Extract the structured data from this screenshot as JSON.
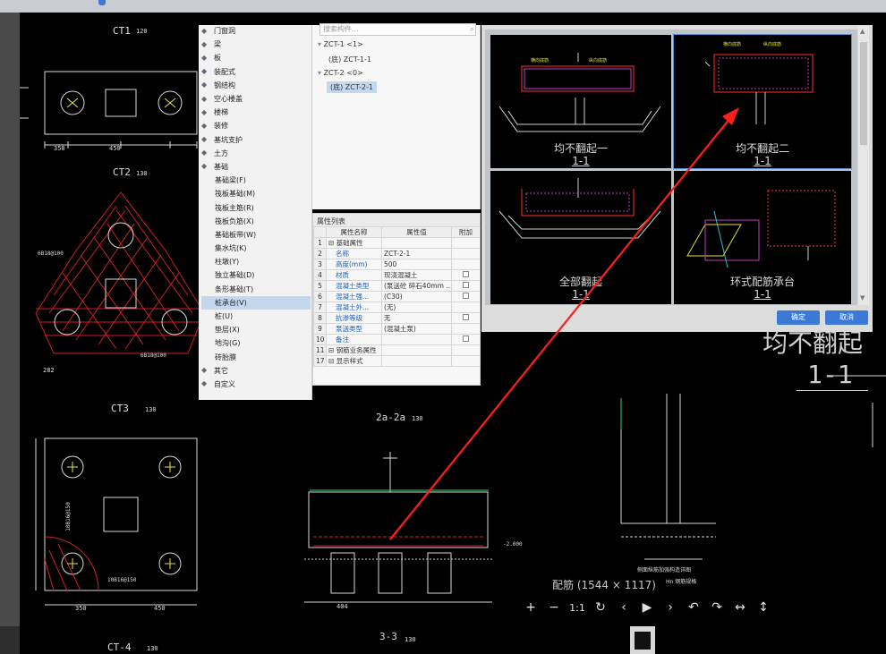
{
  "cad": {
    "labels": {
      "ct1": "CT1",
      "ct1_scale": "120",
      "ct2": "CT2",
      "ct2_scale": "130",
      "ct3": "CT3",
      "ct3_scale": "130",
      "ct4": "CT-4",
      "ct4_scale": "130",
      "sec22": "2a-2a",
      "sec22_scale": "130",
      "sec33": "3-3",
      "sec33_scale": "130",
      "dim350": "350",
      "dim450": "450",
      "dim404": "404",
      "dim282": "282",
      "rebar1": "6B18@100",
      "rebar2": "6B18@100",
      "rebar3": "10B16@150",
      "rebar4": "10B16@150",
      "elev": "-2.000",
      "big_caption": "均不翻起",
      "big_section": "1-1",
      "detail_title": "侧面纵筋加强构造详图",
      "detail_sub": "Hn 钢筋规格"
    }
  },
  "tree": {
    "items": [
      {
        "label": "门窗洞",
        "icon": "door-icon"
      },
      {
        "label": "梁",
        "icon": "beam-icon"
      },
      {
        "label": "板",
        "icon": "slab-icon"
      },
      {
        "label": "装配式",
        "icon": "prefab-icon"
      },
      {
        "label": "钢结构",
        "icon": "steel-icon"
      },
      {
        "label": "空心楼盖",
        "icon": "hollow-floor-icon"
      },
      {
        "label": "楼梯",
        "icon": "stair-icon"
      },
      {
        "label": "装修",
        "icon": "decoration-icon"
      },
      {
        "label": "基坑支护",
        "icon": "support-icon"
      },
      {
        "label": "土方",
        "icon": "earth-icon"
      },
      {
        "label": "基础",
        "icon": "foundation-icon"
      }
    ],
    "sub_items": [
      {
        "label": "基础梁(F)"
      },
      {
        "label": "筏板基础(M)"
      },
      {
        "label": "筏板主筋(R)"
      },
      {
        "label": "筏板负筋(X)"
      },
      {
        "label": "基础板带(W)"
      },
      {
        "label": "集水坑(K)"
      },
      {
        "label": "柱墩(Y)"
      },
      {
        "label": "独立基础(D)"
      },
      {
        "label": "条形基础(T)"
      },
      {
        "label": "桩承台(V)"
      },
      {
        "label": "桩(U)"
      },
      {
        "label": "垫层(X)"
      },
      {
        "label": "地沟(G)"
      },
      {
        "label": "砖胎膜"
      }
    ],
    "tail_items": [
      {
        "label": "其它",
        "icon": "other-icon"
      },
      {
        "label": "自定义",
        "icon": "custom-icon"
      }
    ]
  },
  "instances": {
    "search_placeholder": "搜索构件...",
    "rows": [
      {
        "label": "ZCT-1 <1>"
      },
      {
        "label": "(底) ZCT-1-1"
      },
      {
        "label": "ZCT-2 <0>"
      },
      {
        "label": "(底) ZCT-2-1"
      }
    ]
  },
  "props": {
    "title": "属性列表",
    "headers": [
      "属性名称",
      "属性值",
      "附加"
    ],
    "rows": [
      {
        "num": "1",
        "name": "基础属性",
        "value": "",
        "check": false,
        "group": true
      },
      {
        "num": "2",
        "name": "名称",
        "value": "ZCT-2-1",
        "check": false
      },
      {
        "num": "3",
        "name": "高度(mm)",
        "value": "500",
        "check": false
      },
      {
        "num": "4",
        "name": "材质",
        "value": "现浇混凝土",
        "check": true
      },
      {
        "num": "5",
        "name": "混凝土类型",
        "value": "(泵送砼 碎石40mm ...",
        "check": true
      },
      {
        "num": "6",
        "name": "混凝土强...",
        "value": "(C30)",
        "check": true
      },
      {
        "num": "7",
        "name": "混凝土外...",
        "value": "(无)",
        "check": false
      },
      {
        "num": "8",
        "name": "抗渗等级",
        "value": "无",
        "check": true
      },
      {
        "num": "9",
        "name": "泵送类型",
        "value": "(混凝土泵)",
        "check": false
      },
      {
        "num": "10",
        "name": "备注",
        "value": "",
        "check": true
      },
      {
        "num": "11",
        "name": "钢筋业务属性",
        "value": "",
        "check": false,
        "group": true
      },
      {
        "num": "17",
        "name": "显示样式",
        "value": "",
        "check": false,
        "group": true
      }
    ]
  },
  "dialog": {
    "options": [
      {
        "caption": "均不翻起一",
        "section": "1-1"
      },
      {
        "caption": "均不翻起二",
        "section": "1-1"
      },
      {
        "caption": "全部翻起",
        "section": "1-1"
      },
      {
        "caption": "环式配筋承台",
        "section": "1-1"
      }
    ],
    "ok": "确定",
    "cancel": "取消"
  },
  "viewer": {
    "title": "配筋 (1544 × 1117)",
    "tools": [
      "+",
      "−",
      "1:1",
      "↻",
      "‹",
      "▶",
      "›",
      "↶",
      "↷",
      "↔",
      "↕"
    ]
  },
  "colors": {
    "annotation_arrow": "#ff1e1e",
    "accent": "#3a79d6"
  }
}
